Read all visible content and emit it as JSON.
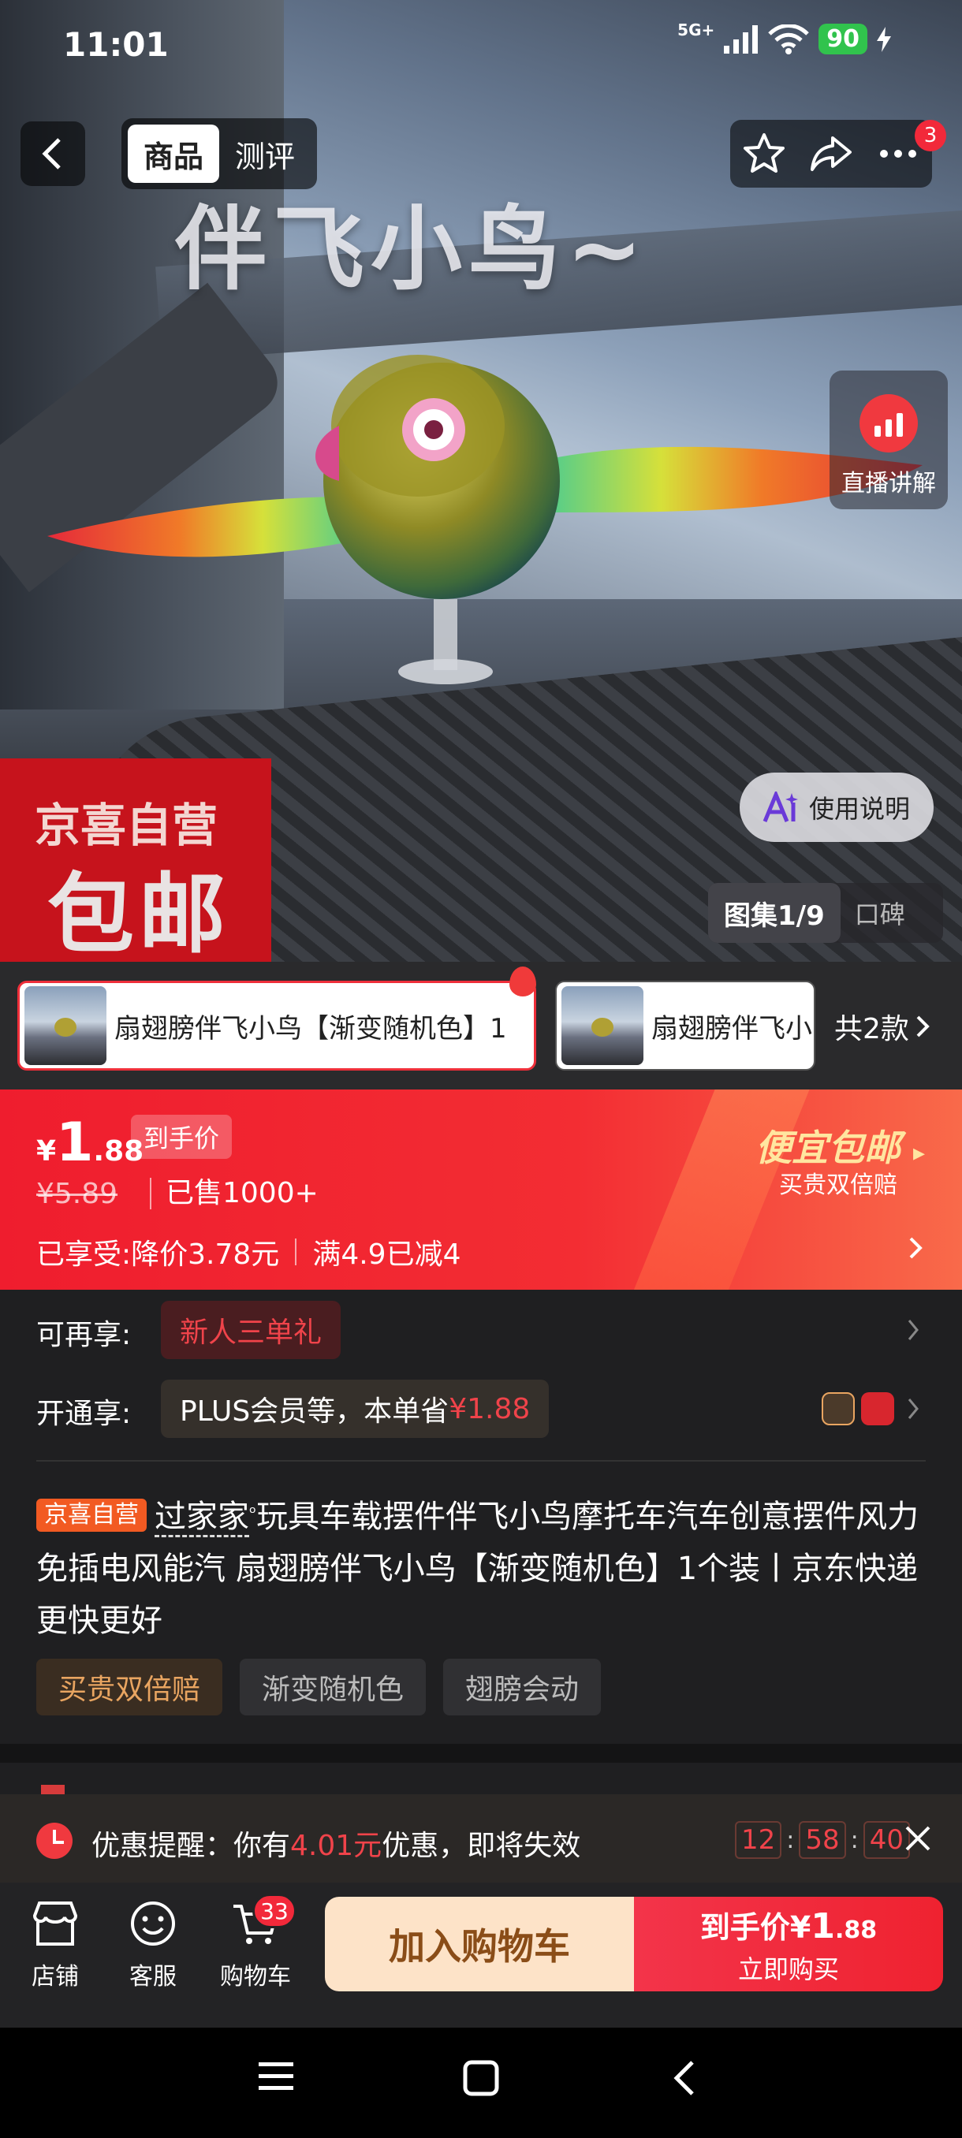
{
  "status_bar": {
    "time": "11:01",
    "network": "5G+",
    "battery": "90"
  },
  "nav": {
    "tabs": [
      {
        "label": "商品"
      },
      {
        "label": "测评"
      }
    ],
    "more_badge": "3"
  },
  "hero": {
    "overlay_text": "伴飞小鸟~",
    "live_label": "直播讲解",
    "promo_small": "京喜自营",
    "promo_big": "包邮",
    "manual_label": "使用说明",
    "gallery_label": "图集1/9",
    "reviews_label": "口碑"
  },
  "variants": {
    "items": [
      {
        "label": "扇翅膀伴飞小鸟【渐变随机色】1"
      },
      {
        "label": "扇翅膀伴飞小"
      }
    ],
    "count_label": "共2款"
  },
  "price": {
    "currency": "¥",
    "integer": "1",
    "decimal": ".88",
    "tag": "到手价",
    "original": "¥5.89",
    "sold": "已售1000+",
    "enjoy_prefix": "已享受:",
    "discount1": "降价3.78元",
    "discount2": "满4.9已减4",
    "promo_title": "便宜包邮",
    "promo_sub": "买贵双倍赔"
  },
  "details": {
    "row1_label": "可再享:",
    "row1_chip": "新人三单礼",
    "row2_label": "开通享:",
    "row2_chip_prefix": "PLUS会员等，本单省",
    "row2_chip_amount": "¥1.88",
    "title_tag": "京喜自营",
    "title_brand": "过家家",
    "title_text": "玩具车载摆件伴飞小鸟摩托车汽车创意摆件风力免插电风能汽 扇翅膀伴飞小鸟【渐变随机色】1个装丨京东快递 更快更好",
    "feature_tags": [
      "买贵双倍赔",
      "渐变随机色",
      "翅膀会动"
    ]
  },
  "reminder": {
    "prefix": "优惠提醒：你有",
    "amount": "4.01元",
    "suffix": "优惠，即将失效",
    "hh": "12",
    "mm": "58",
    "ss": "40"
  },
  "bottom_bar": {
    "store": "店铺",
    "service": "客服",
    "cart": "购物车",
    "cart_count": "33",
    "add_cart": "加入购物车",
    "buy_line1_prefix": "到手价",
    "buy_price_cur": "¥",
    "buy_price_int": "1",
    "buy_price_dec": ".88",
    "buy_line2": "立即购买"
  },
  "colors": {
    "accent_red": "#ef1d2e",
    "gold": "#e9a561",
    "cream": "#fde3c8"
  }
}
